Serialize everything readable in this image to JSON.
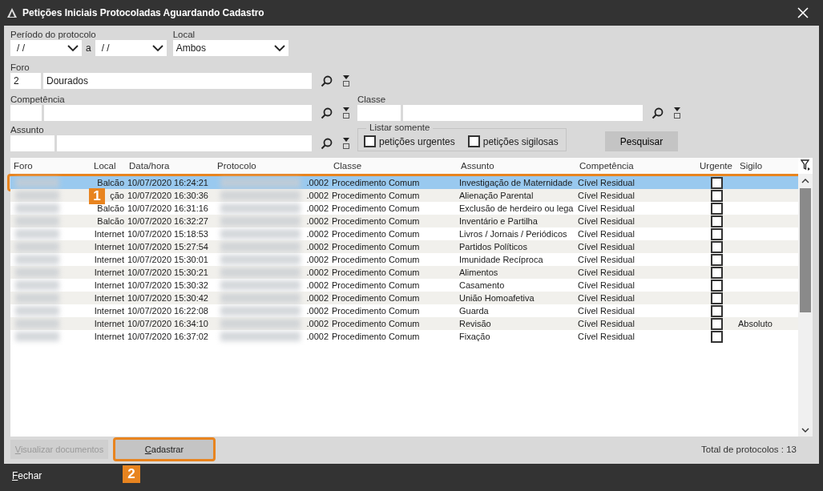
{
  "window": {
    "title": "Petições Iniciais Protocoladas Aguardando Cadastro"
  },
  "filters": {
    "periodo_label": "Período do protocolo",
    "date_from": "/ /",
    "range_sep": "a",
    "date_to": "/ /",
    "local_label": "Local",
    "local_value": "Ambos",
    "foro_label": "Foro",
    "foro_code": "2",
    "foro_name": "Dourados",
    "competencia_label": "Competência",
    "classe_label": "Classe",
    "assunto_label": "Assunto",
    "listar_label": "Listar somente",
    "options": [
      {
        "label": "petições urgentes",
        "checked": false
      },
      {
        "label": "petições sigilosas",
        "checked": false
      }
    ],
    "search_button": "Pesquisar"
  },
  "table": {
    "columns": [
      "Foro",
      "Local",
      "Data/hora",
      "Protocolo",
      "Classe",
      "Assunto",
      "Competência",
      "Urgente",
      "Sigilo"
    ],
    "rows": [
      {
        "local": "Balcão",
        "datetime": "10/07/2020 16:24:21",
        "protocol": ".0002",
        "classe": "Procedimento Comum",
        "assunto": "Investigação de Maternidade",
        "competencia": "Cível Residual",
        "urgent": false,
        "sigilo": "",
        "selected": true
      },
      {
        "local": "ção",
        "datetime": "10/07/2020 16:30:36",
        "protocol": ".0002",
        "classe": "Procedimento Comum",
        "assunto": "Alienação Parental",
        "competencia": "Cível Residual",
        "urgent": false,
        "sigilo": "",
        "selected": false
      },
      {
        "local": "Balcão",
        "datetime": "10/07/2020 16:31:16",
        "protocol": ".0002",
        "classe": "Procedimento Comum",
        "assunto": "Exclusão de herdeiro ou lega",
        "competencia": "Cível Residual",
        "urgent": false,
        "sigilo": "",
        "selected": false
      },
      {
        "local": "Balcão",
        "datetime": "10/07/2020 16:32:27",
        "protocol": ".0002",
        "classe": "Procedimento Comum",
        "assunto": "Inventário e Partilha",
        "competencia": "Cível Residual",
        "urgent": false,
        "sigilo": "",
        "selected": false
      },
      {
        "local": "Internet",
        "datetime": "10/07/2020 15:18:53",
        "protocol": ".0002",
        "classe": "Procedimento Comum",
        "assunto": "Livros / Jornais / Periódicos",
        "competencia": "Cível Residual",
        "urgent": false,
        "sigilo": "",
        "selected": false
      },
      {
        "local": "Internet",
        "datetime": "10/07/2020 15:27:54",
        "protocol": ".0002",
        "classe": "Procedimento Comum",
        "assunto": "Partidos Políticos",
        "competencia": "Cível Residual",
        "urgent": false,
        "sigilo": "",
        "selected": false
      },
      {
        "local": "Internet",
        "datetime": "10/07/2020 15:30:01",
        "protocol": ".0002",
        "classe": "Procedimento Comum",
        "assunto": "Imunidade Recíproca",
        "competencia": "Cível Residual",
        "urgent": false,
        "sigilo": "",
        "selected": false
      },
      {
        "local": "Internet",
        "datetime": "10/07/2020 15:30:21",
        "protocol": ".0002",
        "classe": "Procedimento Comum",
        "assunto": "Alimentos",
        "competencia": "Cível Residual",
        "urgent": false,
        "sigilo": "",
        "selected": false
      },
      {
        "local": "Internet",
        "datetime": "10/07/2020 15:30:32",
        "protocol": ".0002",
        "classe": "Procedimento Comum",
        "assunto": "Casamento",
        "competencia": "Cível Residual",
        "urgent": false,
        "sigilo": "",
        "selected": false
      },
      {
        "local": "Internet",
        "datetime": "10/07/2020 15:30:42",
        "protocol": ".0002",
        "classe": "Procedimento Comum",
        "assunto": "União Homoafetiva",
        "competencia": "Cível Residual",
        "urgent": false,
        "sigilo": "",
        "selected": false
      },
      {
        "local": "Internet",
        "datetime": "10/07/2020 16:22:08",
        "protocol": ".0002",
        "classe": "Procedimento Comum",
        "assunto": "Guarda",
        "competencia": "Cível Residual",
        "urgent": false,
        "sigilo": "",
        "selected": false
      },
      {
        "local": "Internet",
        "datetime": "10/07/2020 16:34:10",
        "protocol": ".0002",
        "classe": "Procedimento Comum",
        "assunto": "Revisão",
        "competencia": "Cível Residual",
        "urgent": false,
        "sigilo": "Absoluto",
        "selected": false
      },
      {
        "local": "Internet",
        "datetime": "10/07/2020 16:37:02",
        "protocol": ".0002",
        "classe": "Procedimento Comum",
        "assunto": "Fixação",
        "competencia": "Cível Residual",
        "urgent": false,
        "sigilo": "",
        "selected": false
      }
    ]
  },
  "actions": [
    {
      "label": "Visualizar documentos",
      "disabled": true,
      "highlighted": false
    },
    {
      "label": "Cadastrar",
      "disabled": false,
      "highlighted": true
    }
  ],
  "total": "Total de protocolos : 13",
  "annotations": [
    "1",
    "2"
  ],
  "footer": {
    "close": "Fechar"
  }
}
